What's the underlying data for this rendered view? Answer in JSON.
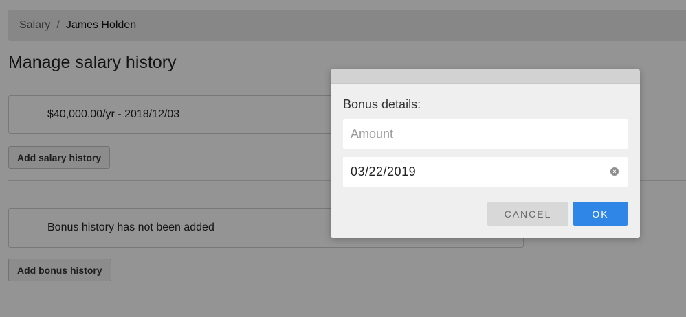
{
  "breadcrumb": {
    "root": "Salary",
    "separator": "/",
    "current": "James Holden"
  },
  "page_title": "Manage salary history",
  "salary_section": {
    "entry": "$40,000.00/yr - 2018/12/03",
    "add_button": "Add salary history"
  },
  "bonus_section": {
    "empty_message": "Bonus history has not been added",
    "add_button": "Add bonus history"
  },
  "dialog": {
    "label": "Bonus details:",
    "amount_placeholder": "Amount",
    "amount_value": "",
    "date_value": "03/22/2019",
    "clear_icon": "clear-circle-icon",
    "cancel_label": "CANCEL",
    "ok_label": "OK"
  },
  "colors": {
    "primary": "#2f86e6",
    "overlay": "rgba(0,0,0,0.42)"
  }
}
